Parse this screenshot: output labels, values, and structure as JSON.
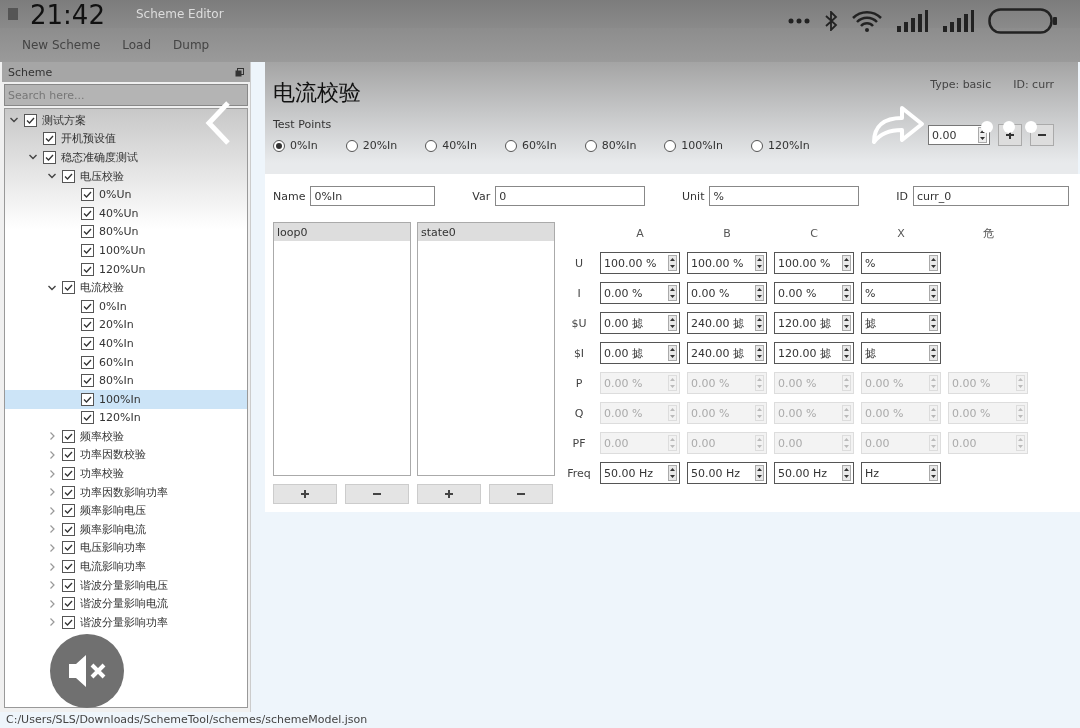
{
  "window": {
    "title": "Scheme Editor"
  },
  "menu": [
    "New Scheme",
    "Load",
    "Dump"
  ],
  "sidebar": {
    "title": "Scheme",
    "search": {
      "placeholder": "Search here..."
    },
    "tree": [
      {
        "label": "测试方案",
        "checked": true,
        "expanded": true,
        "selected": false,
        "children": [
          {
            "label": "开机预设值",
            "checked": true,
            "selected": false
          },
          {
            "label": "稳态准确度测试",
            "checked": true,
            "expanded": true,
            "selected": false,
            "children": [
              {
                "label": "电压校验",
                "checked": true,
                "expanded": true,
                "selected": false,
                "children": [
                  {
                    "label": "0%Un",
                    "checked": true,
                    "selected": false
                  },
                  {
                    "label": "40%Un",
                    "checked": true,
                    "selected": false
                  },
                  {
                    "label": "80%Un",
                    "checked": true,
                    "selected": false
                  },
                  {
                    "label": "100%Un",
                    "checked": true,
                    "selected": false
                  },
                  {
                    "label": "120%Un",
                    "checked": true,
                    "selected": false
                  }
                ]
              },
              {
                "label": "电流校验",
                "checked": true,
                "expanded": true,
                "selected": false,
                "children": [
                  {
                    "label": "0%In",
                    "checked": true,
                    "selected": false
                  },
                  {
                    "label": "20%In",
                    "checked": true,
                    "selected": false
                  },
                  {
                    "label": "40%In",
                    "checked": true,
                    "selected": false
                  },
                  {
                    "label": "60%In",
                    "checked": true,
                    "selected": false
                  },
                  {
                    "label": "80%In",
                    "checked": true,
                    "selected": false
                  },
                  {
                    "label": "100%In",
                    "checked": true,
                    "selected": true
                  },
                  {
                    "label": "120%In",
                    "checked": true,
                    "selected": false
                  }
                ]
              },
              {
                "label": "频率校验",
                "checked": true,
                "expanded": false,
                "selected": false
              },
              {
                "label": "功率因数校验",
                "checked": true,
                "expanded": false,
                "selected": false
              },
              {
                "label": "功率校验",
                "checked": true,
                "expanded": false,
                "selected": false
              },
              {
                "label": "功率因数影响功率",
                "checked": true,
                "expanded": false,
                "selected": false
              },
              {
                "label": "频率影响电压",
                "checked": true,
                "expanded": false,
                "selected": false
              },
              {
                "label": "频率影响电流",
                "checked": true,
                "expanded": false,
                "selected": false
              },
              {
                "label": "电压影响功率",
                "checked": true,
                "expanded": false,
                "selected": false
              },
              {
                "label": "电流影响功率",
                "checked": true,
                "expanded": false,
                "selected": false
              },
              {
                "label": "谐波分量影响电压",
                "checked": true,
                "expanded": false,
                "selected": false
              },
              {
                "label": "谐波分量影响电流",
                "checked": true,
                "expanded": false,
                "selected": false
              },
              {
                "label": "谐波分量影响功率",
                "checked": true,
                "expanded": false,
                "selected": false
              }
            ]
          }
        ]
      }
    ]
  },
  "main": {
    "title": "电流校验",
    "type": "Type: basic",
    "id": "ID: curr",
    "test_points": {
      "label": "Test Points",
      "options": [
        {
          "label": "0%In",
          "selected": true
        },
        {
          "label": "20%In",
          "selected": false
        },
        {
          "label": "40%In",
          "selected": false
        },
        {
          "label": "60%In",
          "selected": false
        },
        {
          "label": "80%In",
          "selected": false
        },
        {
          "label": "100%In",
          "selected": false
        },
        {
          "label": "120%In",
          "selected": false
        }
      ],
      "spin_value": "0.00"
    },
    "fields": [
      {
        "label": "Name",
        "value": "0%In"
      },
      {
        "label": "Var",
        "value": "0"
      },
      {
        "label": "Unit",
        "value": "%"
      },
      {
        "label": "ID",
        "value": "curr_0"
      }
    ],
    "lists": [
      {
        "items": [
          {
            "label": "loop0",
            "selected": true
          }
        ]
      },
      {
        "items": [
          {
            "label": "state0",
            "selected": true
          }
        ]
      }
    ],
    "grid": {
      "columns": [
        "A",
        "B",
        "C",
        "X",
        "危"
      ],
      "rows": [
        {
          "label": "U",
          "cells": [
            {
              "value": "100.00 %",
              "disabled": false
            },
            {
              "value": "100.00 %",
              "disabled": false
            },
            {
              "value": "100.00 %",
              "disabled": false
            },
            {
              "value": "%",
              "disabled": false
            }
          ]
        },
        {
          "label": "I",
          "cells": [
            {
              "value": "0.00 %",
              "disabled": false
            },
            {
              "value": "0.00 %",
              "disabled": false
            },
            {
              "value": "0.00 %",
              "disabled": false
            },
            {
              "value": "%",
              "disabled": false
            }
          ]
        },
        {
          "label": "$U",
          "cells": [
            {
              "value": "0.00 摅",
              "disabled": false
            },
            {
              "value": "240.00 摅",
              "disabled": false
            },
            {
              "value": "120.00 摅",
              "disabled": false
            },
            {
              "value": "摅",
              "disabled": false
            }
          ]
        },
        {
          "label": "$I",
          "cells": [
            {
              "value": "0.00 摅",
              "disabled": false
            },
            {
              "value": "240.00 摅",
              "disabled": false
            },
            {
              "value": "120.00 摅",
              "disabled": false
            },
            {
              "value": "摅",
              "disabled": false
            }
          ]
        },
        {
          "label": "P",
          "cells": [
            {
              "value": "0.00 %",
              "disabled": true
            },
            {
              "value": "0.00 %",
              "disabled": true
            },
            {
              "value": "0.00 %",
              "disabled": true
            },
            {
              "value": "0.00 %",
              "disabled": true
            },
            {
              "value": "0.00 %",
              "disabled": true
            }
          ]
        },
        {
          "label": "Q",
          "cells": [
            {
              "value": "0.00 %",
              "disabled": true
            },
            {
              "value": "0.00 %",
              "disabled": true
            },
            {
              "value": "0.00 %",
              "disabled": true
            },
            {
              "value": "0.00 %",
              "disabled": true
            },
            {
              "value": "0.00 %",
              "disabled": true
            }
          ]
        },
        {
          "label": "PF",
          "cells": [
            {
              "value": "0.00",
              "disabled": true
            },
            {
              "value": "0.00",
              "disabled": true
            },
            {
              "value": "0.00",
              "disabled": true
            },
            {
              "value": "0.00",
              "disabled": true
            },
            {
              "value": "0.00",
              "disabled": true
            }
          ]
        },
        {
          "label": "Freq",
          "cells": [
            {
              "value": "50.00 Hz",
              "disabled": false
            },
            {
              "value": "50.00 Hz",
              "disabled": false
            },
            {
              "value": "50.00 Hz",
              "disabled": false
            },
            {
              "value": "Hz",
              "disabled": false
            }
          ]
        }
      ]
    }
  },
  "status_bar": {
    "path": "C:/Users/SLS/Downloads/SchemeTool/schemes/schemeModel.json"
  },
  "phone_overlay": {
    "time": "21:42"
  }
}
